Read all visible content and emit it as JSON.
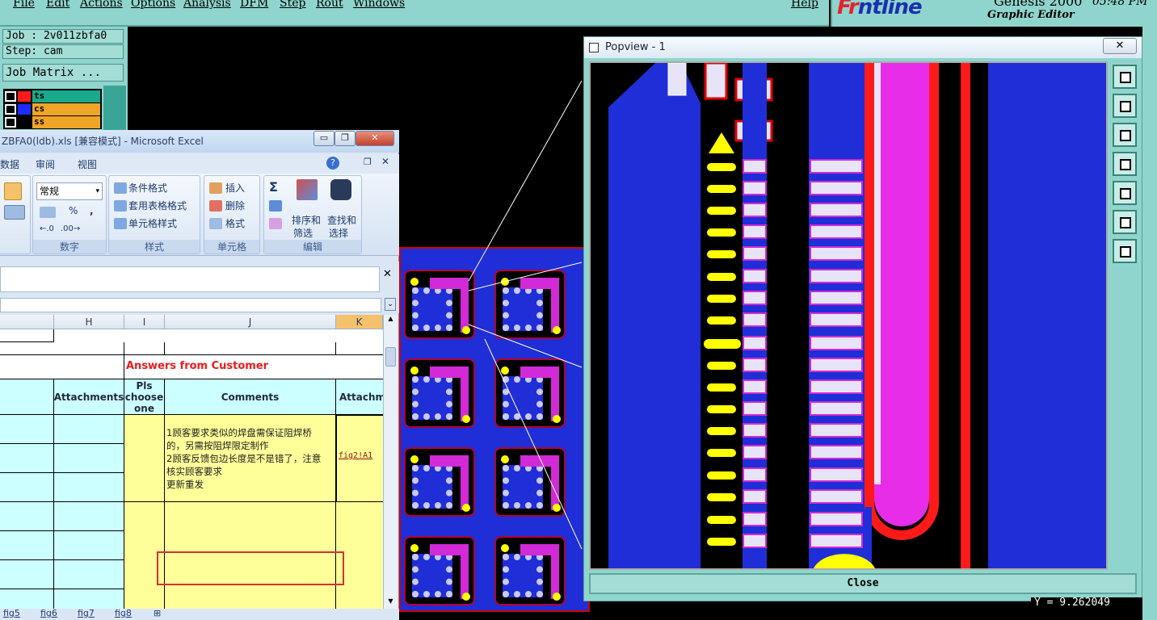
{
  "menu": {
    "file": "File",
    "edit": "Edit",
    "actions": "Actions",
    "options": "Options",
    "analysis": "Analysis",
    "dfm": "DFM",
    "step": "Step",
    "rout": "Rout",
    "windows": "Windows",
    "help": "Help"
  },
  "brand": {
    "logo_a": "Fr",
    "logo_b": "ntline",
    "version": "Genesis 2000",
    "subtitle": "Graphic Editor",
    "time": "05:48 PM"
  },
  "genesis": {
    "job": "Job : 2v011zbfa0",
    "step": "Step: cam",
    "job_matrix": "Job Matrix ...",
    "layers": [
      {
        "name": "ts",
        "color": "#1aa98c",
        "swatch": "#ff1a1a"
      },
      {
        "name": "cs",
        "color": "#f0a428",
        "swatch": "#1a2cff"
      },
      {
        "name": "ss",
        "color": "#f0a428",
        "swatch": "#000000"
      }
    ]
  },
  "excel": {
    "title": "ZBFA0(ldb).xls  [兼容模式] - Microsoft Excel",
    "tabs": {
      "data": "数据",
      "review": "审阅",
      "view": "视图"
    },
    "ribbon": {
      "format_value": "常规",
      "number_group": "数字",
      "cond_format": "条件格式",
      "table_format": "套用表格格式",
      "cell_style": "单元格样式",
      "style_group": "样式",
      "insert": "插入",
      "delete": "删除",
      "format": "格式",
      "cells_group": "单元格",
      "sort_filter_1": "排序和",
      "sort_filter_2": "筛选",
      "find_select_1": "查找和",
      "find_select_2": "选择",
      "edit_group": "编辑",
      "sum": "Σ",
      "percent": "%",
      "comma": ","
    },
    "columns": [
      "H",
      "I",
      "J",
      "K"
    ],
    "answers_title": "Answers from Customer",
    "headers": {
      "attachments": "Attachments",
      "pls1": "Pls",
      "pls2": "choose",
      "pls3": "one",
      "comments": "Comments",
      "attachme": "Attachme"
    },
    "comment_lines": [
      "1顾客要求类似的焊盘需保证阻焊桥",
      "的，另需按阻焊限定制作",
      "2顾客反馈包边长度是不是错了，注意",
      "核实顾客要求",
      "更新重发"
    ],
    "link": "fig2!A1",
    "sheet_tabs": [
      "fig5",
      "fig6",
      "fig7",
      "fig8"
    ],
    "colors": {
      "answers": "#e81c1c",
      "cyan_cell": "#ccffff",
      "yellow_cell": "#ffff99",
      "highlight_box": "#d83030"
    }
  },
  "popview": {
    "title": "Popview - 1",
    "close": "Close",
    "close_x": "✕"
  },
  "status": {
    "coord": "Y = 9.262049"
  }
}
